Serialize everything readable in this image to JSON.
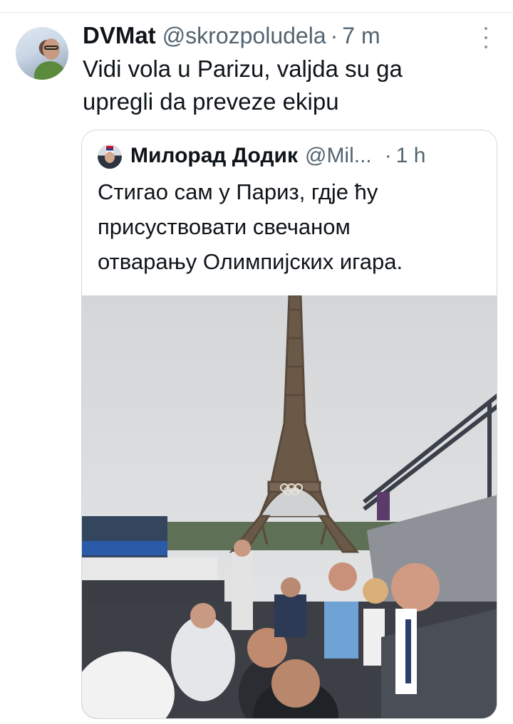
{
  "tweet": {
    "author_name": "DVMat",
    "author_handle": "@skrozpoludela",
    "separator": "·",
    "time": "7 m",
    "text": "Vidi vola u Parizu, valjda su ga\nupregli da preveze ekipu",
    "avatar_icon": "user-avatar",
    "more_icon": "more-options-icon"
  },
  "quoted_tweet": {
    "author_name": "Милорад Додик",
    "author_handle": "@Mil...",
    "separator": "·",
    "time": "1 h",
    "text": "Стигао сам у Париз, гдје ћу\nприсуствовати свечаном\nотварању Олимпијских игара.",
    "avatar_icon": "user-avatar",
    "media": {
      "kind": "photo",
      "description_icon": "photo-media"
    }
  },
  "colors": {
    "text_primary": "#0f1419",
    "text_secondary": "#536471",
    "border": "#cfd9de"
  }
}
